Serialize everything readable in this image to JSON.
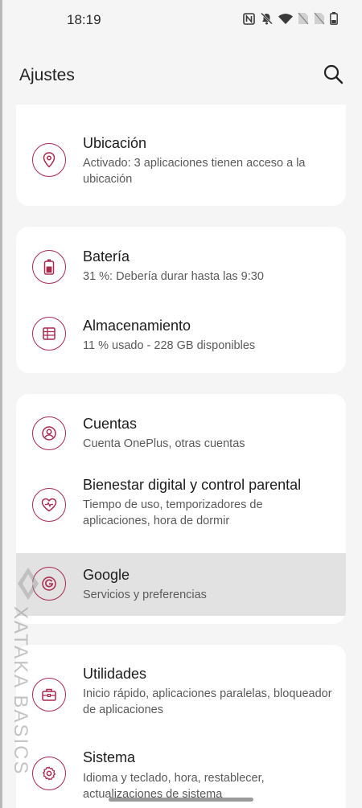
{
  "status_bar": {
    "time": "18:19",
    "icons": [
      "nfc-icon",
      "mute-icon",
      "wifi-icon",
      "no-sim-icon",
      "no-sim-icon",
      "battery-icon"
    ]
  },
  "header": {
    "title": "Ajustes",
    "search_icon": "search-icon"
  },
  "cards": [
    {
      "items": [
        {
          "icon": "location-pin-icon",
          "title": "Ubicación",
          "subtitle": "Activado: 3 aplicaciones tienen acceso a la ubicación"
        }
      ]
    },
    {
      "items": [
        {
          "icon": "battery-icon",
          "title": "Batería",
          "subtitle": "31 %: Debería durar hasta las 9:30"
        },
        {
          "icon": "storage-icon",
          "title": "Almacenamiento",
          "subtitle": "11 % usado - 228 GB disponibles"
        }
      ]
    },
    {
      "items": [
        {
          "icon": "account-icon",
          "title": "Cuentas",
          "subtitle": "Cuenta OnePlus, otras cuentas"
        },
        {
          "icon": "digital-wellbeing-icon",
          "title": "Bienestar digital y control parental",
          "subtitle": "Tiempo de uso, temporizadores de aplicaciones, hora de dormir"
        },
        {
          "icon": "google-icon",
          "title": "Google",
          "subtitle": "Servicios y preferencias",
          "highlighted": true
        }
      ]
    },
    {
      "items": [
        {
          "icon": "toolbox-icon",
          "title": "Utilidades",
          "subtitle": "Inicio rápido, aplicaciones paralelas, bloqueador de aplicaciones"
        },
        {
          "icon": "gear-icon",
          "title": "Sistema",
          "subtitle": "Idioma y teclado, hora, restablecer, actualizaciones de sistema"
        }
      ]
    }
  ],
  "watermark": "XATAKA BASICS",
  "accent_color": "#a8294e"
}
